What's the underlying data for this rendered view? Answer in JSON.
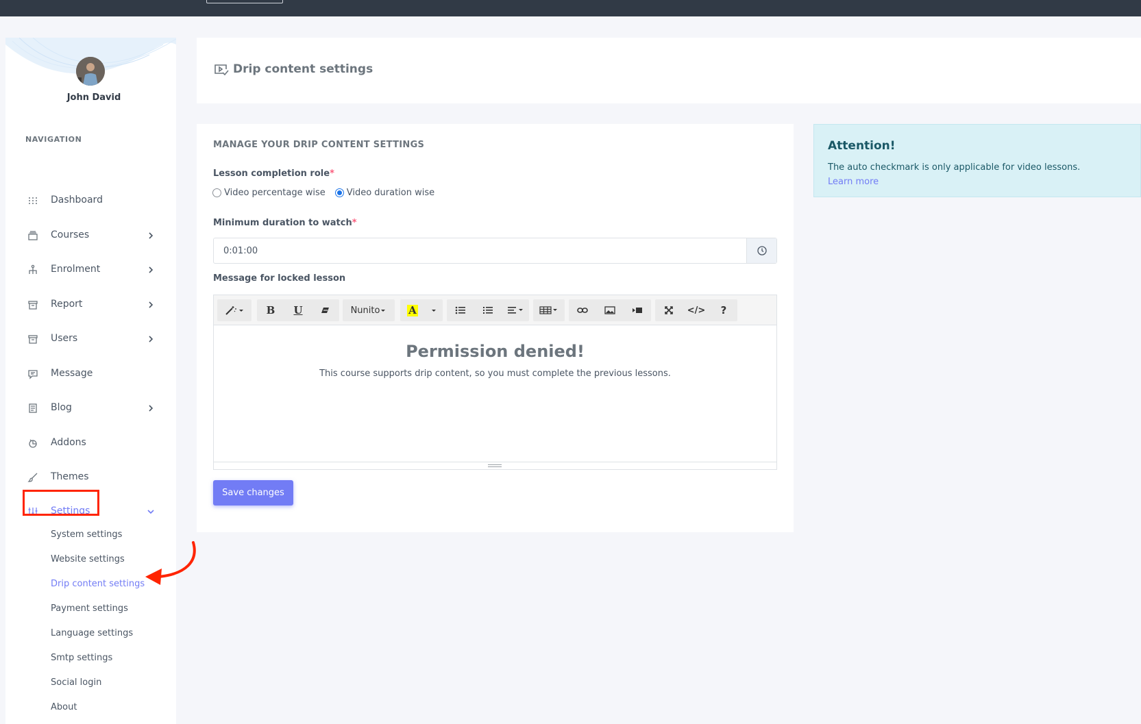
{
  "user": {
    "name": "John David"
  },
  "sidebar": {
    "nav_title": "NAVIGATION",
    "items": [
      {
        "label": "Dashboard",
        "icon": "dashboard-icon",
        "has_chevron": false
      },
      {
        "label": "Courses",
        "icon": "courses-icon",
        "has_chevron": true
      },
      {
        "label": "Enrolment",
        "icon": "enrolment-icon",
        "has_chevron": true
      },
      {
        "label": "Report",
        "icon": "report-icon",
        "has_chevron": true
      },
      {
        "label": "Users",
        "icon": "users-icon",
        "has_chevron": true
      },
      {
        "label": "Message",
        "icon": "message-icon",
        "has_chevron": false
      },
      {
        "label": "Blog",
        "icon": "blog-icon",
        "has_chevron": true
      },
      {
        "label": "Addons",
        "icon": "addons-icon",
        "has_chevron": false
      },
      {
        "label": "Themes",
        "icon": "themes-icon",
        "has_chevron": false
      },
      {
        "label": "Settings",
        "icon": "settings-icon",
        "has_chevron": true,
        "active": true
      }
    ],
    "settings_subitems": [
      "System settings",
      "Website settings",
      "Drip content settings",
      "Payment settings",
      "Language settings",
      "Smtp settings",
      "Social login",
      "About"
    ],
    "active_subitem": "Drip content settings"
  },
  "header": {
    "title": "Drip content settings"
  },
  "form": {
    "card_title": "MANAGE YOUR DRIP CONTENT SETTINGS",
    "completion_label": "Lesson completion role",
    "required_mark": "*",
    "radio_percentage": "Video percentage wise",
    "radio_duration": "Video duration wise",
    "selected_radio": "Video duration wise",
    "min_duration_label": "Minimum duration to watch",
    "min_duration_value": "0:01:00",
    "locked_message_label": "Message for locked lesson",
    "editor": {
      "font_name": "Nunito",
      "heading": "Permission denied!",
      "paragraph": "This course supports drip content, so you must complete the previous lessons.",
      "bold": "B",
      "underline": "U",
      "highlight_letter": "A",
      "help": "?",
      "code": "</>"
    },
    "save_label": "Save changes"
  },
  "alert": {
    "title": "Attention!",
    "text": "The auto checkmark is only applicable for video lessons.",
    "link": "Learn more"
  },
  "colors": {
    "accent": "#727cf5",
    "topbar": "#313a46",
    "alert_bg": "#d9f1f6",
    "annotation": "#ff2400"
  }
}
